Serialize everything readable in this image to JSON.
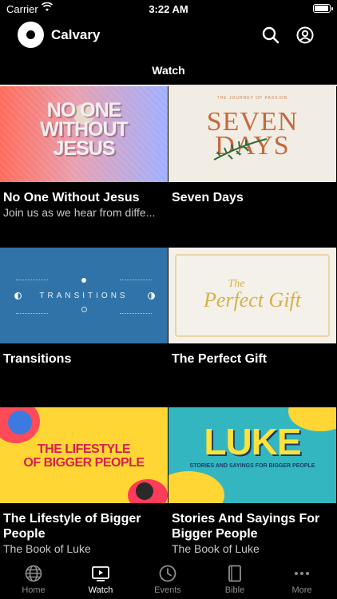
{
  "status": {
    "carrier": "Carrier",
    "time": "3:22 AM",
    "battery_level": 0.95
  },
  "app": {
    "name": "Calvary"
  },
  "section_title": "Watch",
  "cards": [
    {
      "title": "No One Without Jesus",
      "subtitle": "Join us as we hear from diffe...",
      "art_text": [
        "NO ONE",
        "WITHOUT",
        "JESUS"
      ]
    },
    {
      "title": "Seven Days",
      "subtitle": "",
      "art_text": [
        "SEVEN",
        "DAYS"
      ],
      "art_small": "THE JOURNEY OF PASSION"
    },
    {
      "title": "Transitions",
      "subtitle": "",
      "art_text": [
        "TRANSITIONS"
      ]
    },
    {
      "title": "The Perfect Gift",
      "subtitle": "",
      "art_text": [
        "The",
        "Perfect Gift"
      ]
    },
    {
      "title": "The Lifestyle of Bigger People",
      "subtitle": "The Book of Luke",
      "art_text": [
        "THE LIFESTYLE",
        "OF BIGGER PEOPLE"
      ]
    },
    {
      "title": "Stories And Sayings For Bigger People",
      "subtitle": "The Book of Luke",
      "art_text": [
        "LUKE",
        "STORIES AND SAYINGS FOR BIGGER PEOPLE"
      ]
    }
  ],
  "tabs": [
    {
      "label": "Home",
      "icon": "globe-icon",
      "active": false
    },
    {
      "label": "Watch",
      "icon": "play-screen-icon",
      "active": true
    },
    {
      "label": "Events",
      "icon": "clock-icon",
      "active": false
    },
    {
      "label": "Bible",
      "icon": "book-icon",
      "active": false
    },
    {
      "label": "More",
      "icon": "ellipsis-icon",
      "active": false
    }
  ]
}
